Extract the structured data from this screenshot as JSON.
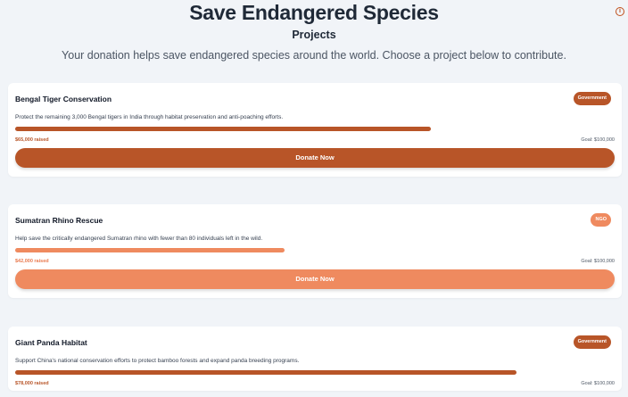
{
  "header": {
    "title": "Save Endangered Species",
    "subtitle": "Projects",
    "lead": "Your donation helps save endangered species around the world. Choose a project below to contribute."
  },
  "info_icon": "i",
  "colors": {
    "background": "#f1f4f8",
    "primary": "#b85528",
    "secondary": "#ef8a5f"
  },
  "projects": [
    {
      "title": "Bengal Tiger Conservation",
      "badge": "Government",
      "description": "Protect the remaining 3,000 Bengal tigers in India through habitat preservation and anti-poaching efforts.",
      "raised": "$65,000 raised",
      "goal": "Goal: $100,000",
      "progress": 0.694,
      "button": "Donate Now",
      "variant": "dark"
    },
    {
      "title": "Sumatran Rhino Rescue",
      "badge": "NGO",
      "description": "Help save the critically endangered Sumatran rhino with fewer than 80 individuals left in the wild.",
      "raised": "$42,000 raised",
      "goal": "Goal: $100,000",
      "progress": 0.45,
      "button": "Donate Now",
      "variant": "light"
    },
    {
      "title": "Giant Panda Habitat",
      "badge": "Government",
      "description": "Support China's national conservation efforts to protect bamboo forests and expand panda breeding programs.",
      "raised": "$78,000 raised",
      "goal": "Goal: $100,000",
      "progress": 0.836,
      "button": "Donate Now",
      "variant": "dark"
    }
  ]
}
